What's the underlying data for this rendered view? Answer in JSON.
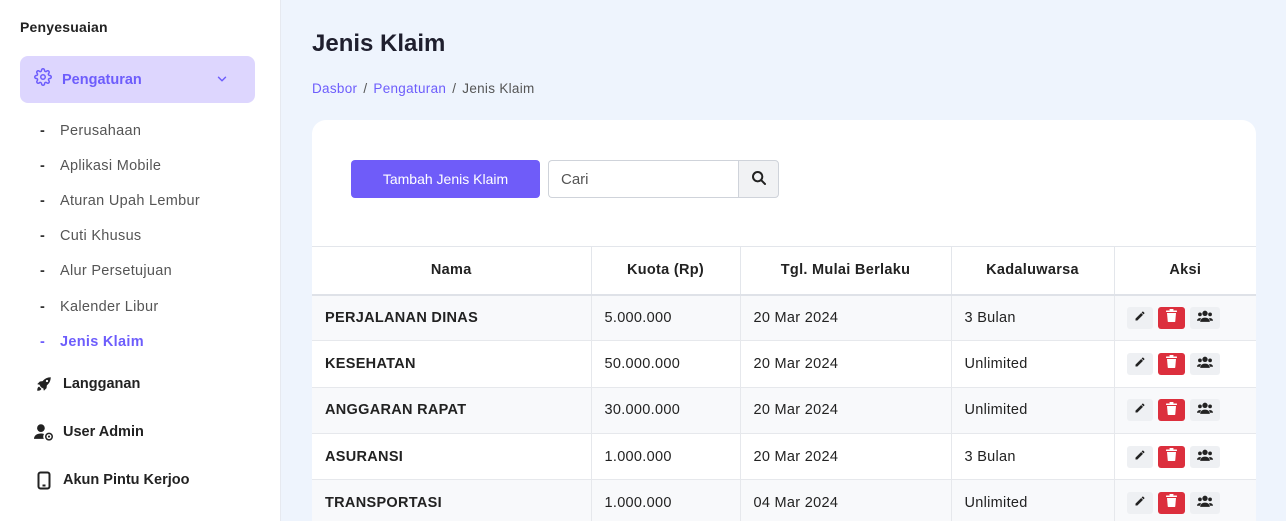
{
  "sidebar": {
    "section_title": "Penyesuaian",
    "active_menu": {
      "label": "Pengaturan",
      "icon": "gear-icon"
    },
    "sub_items": [
      {
        "label": "Perusahaan",
        "active": false
      },
      {
        "label": "Aplikasi Mobile",
        "active": false
      },
      {
        "label": "Aturan Upah Lembur",
        "active": false
      },
      {
        "label": "Cuti Khusus",
        "active": false
      },
      {
        "label": "Alur Persetujuan",
        "active": false
      },
      {
        "label": "Kalender Libur",
        "active": false
      },
      {
        "label": "Jenis Klaim",
        "active": true
      }
    ],
    "nav_items": [
      {
        "label": "Langganan",
        "icon": "rocket-icon"
      },
      {
        "label": "User Admin",
        "icon": "user-cog-icon"
      },
      {
        "label": "Akun Pintu Kerjoo",
        "icon": "mobile-icon"
      }
    ]
  },
  "page": {
    "title": "Jenis Klaim",
    "breadcrumb": [
      {
        "label": "Dasbor",
        "link": true
      },
      {
        "label": "Pengaturan",
        "link": true
      },
      {
        "label": "Jenis Klaim",
        "link": false
      }
    ]
  },
  "toolbar": {
    "add_label": "Tambah Jenis Klaim",
    "search_placeholder": "Cari"
  },
  "table": {
    "headers": [
      "Nama",
      "Kuota (Rp)",
      "Tgl. Mulai Berlaku",
      "Kadaluwarsa",
      "Aksi"
    ],
    "rows": [
      {
        "nama": "PERJALANAN DINAS",
        "kuota": "5.000.000",
        "tgl": "20 Mar 2024",
        "kadaluwarsa": "3 Bulan"
      },
      {
        "nama": "KESEHATAN",
        "kuota": "50.000.000",
        "tgl": "20 Mar 2024",
        "kadaluwarsa": "Unlimited"
      },
      {
        "nama": "ANGGARAN RAPAT",
        "kuota": "30.000.000",
        "tgl": "20 Mar 2024",
        "kadaluwarsa": "Unlimited"
      },
      {
        "nama": "ASURANSI",
        "kuota": "1.000.000",
        "tgl": "20 Mar 2024",
        "kadaluwarsa": "3 Bulan"
      },
      {
        "nama": "TRANSPORTASI",
        "kuota": "1.000.000",
        "tgl": "04 Mar 2024",
        "kadaluwarsa": "Unlimited"
      }
    ]
  },
  "colors": {
    "accent": "#6f5cf9",
    "danger": "#dc2f3d",
    "active_menu_bg": "#ddd6fe"
  }
}
